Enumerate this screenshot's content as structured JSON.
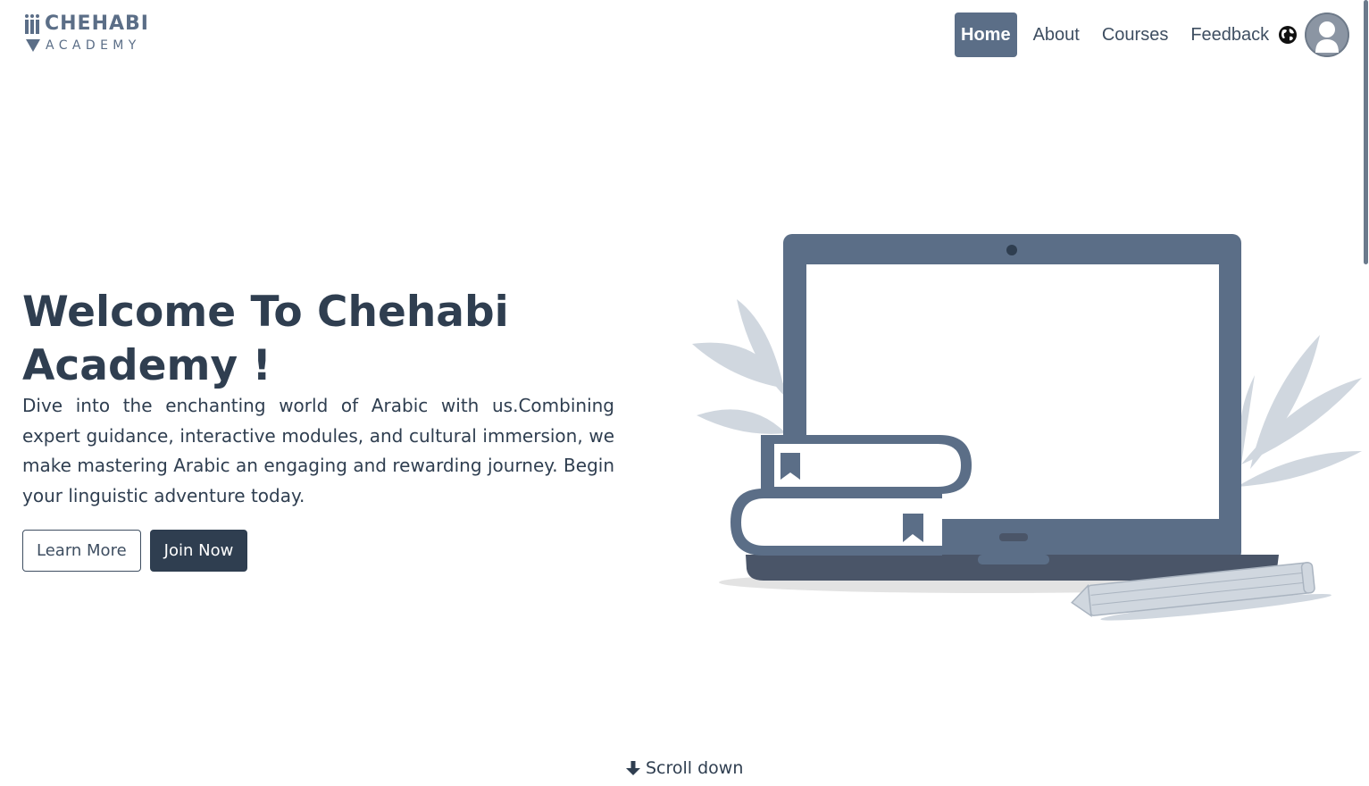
{
  "header": {
    "logo_top": "CHEHABI",
    "logo_bottom": "ACADEMY",
    "nav": [
      {
        "label": "Home",
        "active": true
      },
      {
        "label": "About",
        "active": false
      },
      {
        "label": "Courses",
        "active": false
      },
      {
        "label": "Feedback",
        "active": false
      }
    ],
    "language_icon": "globe-icon",
    "avatar_icon": "user-avatar-icon"
  },
  "hero": {
    "title": "Welcome To Chehabi Academy !",
    "text": "Dive into the enchanting world of Arabic with us.Combining expert guidance, interactive modules, and cultural immersion, we make mastering Arabic an engaging and rewarding journey. Begin your linguistic adventure today.",
    "learn_more_label": "Learn More",
    "join_now_label": "Join Now"
  },
  "scroll_down": {
    "label": "Scroll down",
    "icon": "arrow-down-icon"
  },
  "colors": {
    "primary": "#5b6e87",
    "dark": "#2f3e50",
    "leaf": "#d0d7df"
  }
}
